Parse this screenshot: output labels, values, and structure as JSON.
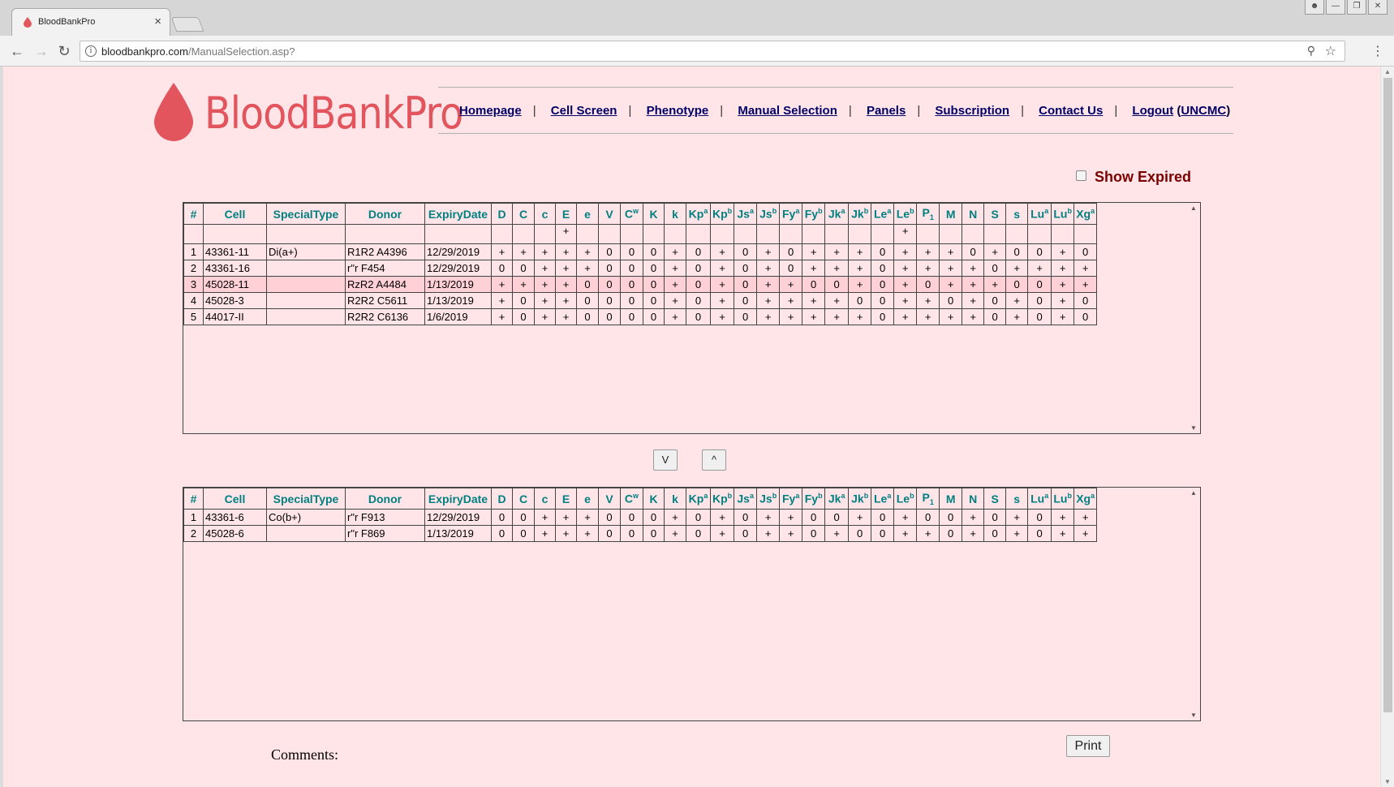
{
  "browser": {
    "tab_title": "BloodBankPro",
    "url_host": "bloodbankpro.com",
    "url_path": "/ManualSelection.asp?"
  },
  "brand": {
    "name": "BloodBankPro",
    "color": "#e2555d"
  },
  "nav": {
    "homepage": "Homepage",
    "cell_screen": "Cell Screen",
    "phenotype": "Phenotype",
    "manual_selection": "Manual Selection",
    "panels": "Panels",
    "subscription": "Subscription",
    "contact_us": "Contact Us",
    "logout": "Logout",
    "account": "UNCMC"
  },
  "show_expired_label": "Show Expired",
  "columns": [
    "#",
    "Cell",
    "SpecialType",
    "Donor",
    "ExpiryDate",
    "D",
    "C",
    "c",
    "E",
    "e",
    "V",
    "C^w",
    "K",
    "k",
    "Kp^a",
    "Kp^b",
    "Js^a",
    "Js^b",
    "Fy^a",
    "Fy^b",
    "Jk^a",
    "Jk^b",
    "Le^a",
    "Le^b",
    "P_1",
    "M",
    "N",
    "S",
    "s",
    "Lu^a",
    "Lu^b",
    "Xg^a"
  ],
  "filter_row": [
    "",
    "",
    "",
    "",
    "",
    "",
    "",
    "",
    "+",
    "",
    "",
    "",
    "",
    "",
    "",
    "",
    "",
    "",
    "",
    "",
    "",
    "",
    "",
    "+",
    "",
    "",
    "",
    "",
    "",
    "",
    "",
    ""
  ],
  "available_cells": [
    [
      "1",
      "43361-11",
      "Di(a+)",
      "R1R2 A4396",
      "12/29/2019",
      "+",
      "+",
      "+",
      "+",
      "+",
      "0",
      "0",
      "0",
      "+",
      "0",
      "+",
      "0",
      "+",
      "0",
      "+",
      "+",
      "+",
      "0",
      "+",
      "+",
      "+",
      "0",
      "+",
      "0",
      "0",
      "+",
      "0"
    ],
    [
      "2",
      "43361-16",
      "",
      "r\"r F454",
      "12/29/2019",
      "0",
      "0",
      "+",
      "+",
      "+",
      "0",
      "0",
      "0",
      "+",
      "0",
      "+",
      "0",
      "+",
      "0",
      "+",
      "+",
      "+",
      "0",
      "+",
      "+",
      "+",
      "+",
      "0",
      "+",
      "+",
      "+",
      "+"
    ],
    [
      "3",
      "45028-11",
      "",
      "RzR2 A4484",
      "1/13/2019",
      "+",
      "+",
      "+",
      "+",
      "0",
      "0",
      "0",
      "0",
      "+",
      "0",
      "+",
      "0",
      "+",
      "+",
      "0",
      "0",
      "+",
      "0",
      "+",
      "0",
      "+",
      "+",
      "+",
      "0",
      "0",
      "+",
      "+"
    ],
    [
      "4",
      "45028-3",
      "",
      "R2R2 C5611",
      "1/13/2019",
      "+",
      "0",
      "+",
      "+",
      "0",
      "0",
      "0",
      "0",
      "+",
      "0",
      "+",
      "0",
      "+",
      "+",
      "+",
      "+",
      "0",
      "0",
      "+",
      "+",
      "0",
      "+",
      "0",
      "+",
      "0",
      "+",
      "0"
    ],
    [
      "5",
      "44017-II",
      "",
      "R2R2 C6136",
      "1/6/2019",
      "+",
      "0",
      "+",
      "+",
      "0",
      "0",
      "0",
      "0",
      "+",
      "0",
      "+",
      "0",
      "+",
      "+",
      "+",
      "+",
      "+",
      "0",
      "+",
      "+",
      "+",
      "+",
      "0",
      "+",
      "0",
      "+",
      "0"
    ]
  ],
  "highlighted_row": 2,
  "move_down_label": "V",
  "move_up_label": "^",
  "selected_cells": [
    [
      "1",
      "43361-6",
      "Co(b+)",
      "r\"r F913",
      "12/29/2019",
      "0",
      "0",
      "+",
      "+",
      "+",
      "0",
      "0",
      "0",
      "+",
      "0",
      "+",
      "0",
      "+",
      "+",
      "0",
      "0",
      "+",
      "0",
      "+",
      "0",
      "0",
      "+",
      "0",
      "+",
      "0",
      "+",
      "+"
    ],
    [
      "2",
      "45028-6",
      "",
      "r\"r F869",
      "1/13/2019",
      "0",
      "0",
      "+",
      "+",
      "+",
      "0",
      "0",
      "0",
      "+",
      "0",
      "+",
      "0",
      "+",
      "+",
      "0",
      "+",
      "0",
      "0",
      "+",
      "+",
      "0",
      "+",
      "0",
      "+",
      "0",
      "+",
      "+"
    ]
  ],
  "comments_label": "Comments:",
  "print_label": "Print"
}
